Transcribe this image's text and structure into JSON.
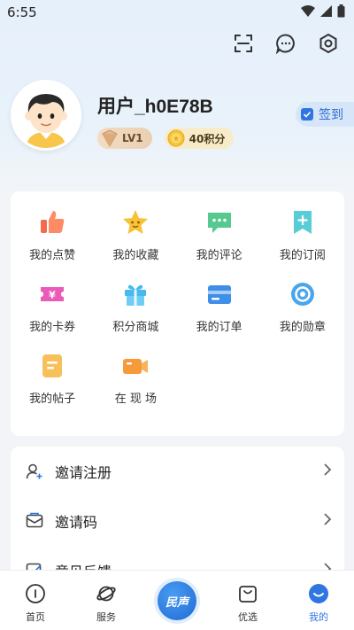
{
  "status_bar": {
    "time": "6:55"
  },
  "profile": {
    "username": "用户_h0E78B",
    "level": "LV1",
    "points": "40积分",
    "checkin_label": "签到"
  },
  "grid": [
    {
      "label": "我的点赞",
      "icon": "thumbs-up-icon"
    },
    {
      "label": "我的收藏",
      "icon": "star-icon"
    },
    {
      "label": "我的评论",
      "icon": "comment-icon"
    },
    {
      "label": "我的订阅",
      "icon": "subscribe-icon"
    },
    {
      "label": "我的卡券",
      "icon": "coupon-icon"
    },
    {
      "label": "积分商城",
      "icon": "gift-icon"
    },
    {
      "label": "我的订单",
      "icon": "order-icon"
    },
    {
      "label": "我的勋章",
      "icon": "medal-icon"
    },
    {
      "label": "我的帖子",
      "icon": "post-icon"
    },
    {
      "label": "在 现 场",
      "icon": "live-camera-icon"
    }
  ],
  "list": [
    {
      "label": "邀请注册",
      "icon": "invite-user-icon"
    },
    {
      "label": "邀请码",
      "icon": "invite-code-icon"
    },
    {
      "label": "意见反馈",
      "icon": "feedback-icon"
    }
  ],
  "tabbar": {
    "home": "首页",
    "services": "服务",
    "center": "民声",
    "selected": "优选",
    "mine": "我的"
  },
  "colors": {
    "accent": "#2f76e0"
  }
}
